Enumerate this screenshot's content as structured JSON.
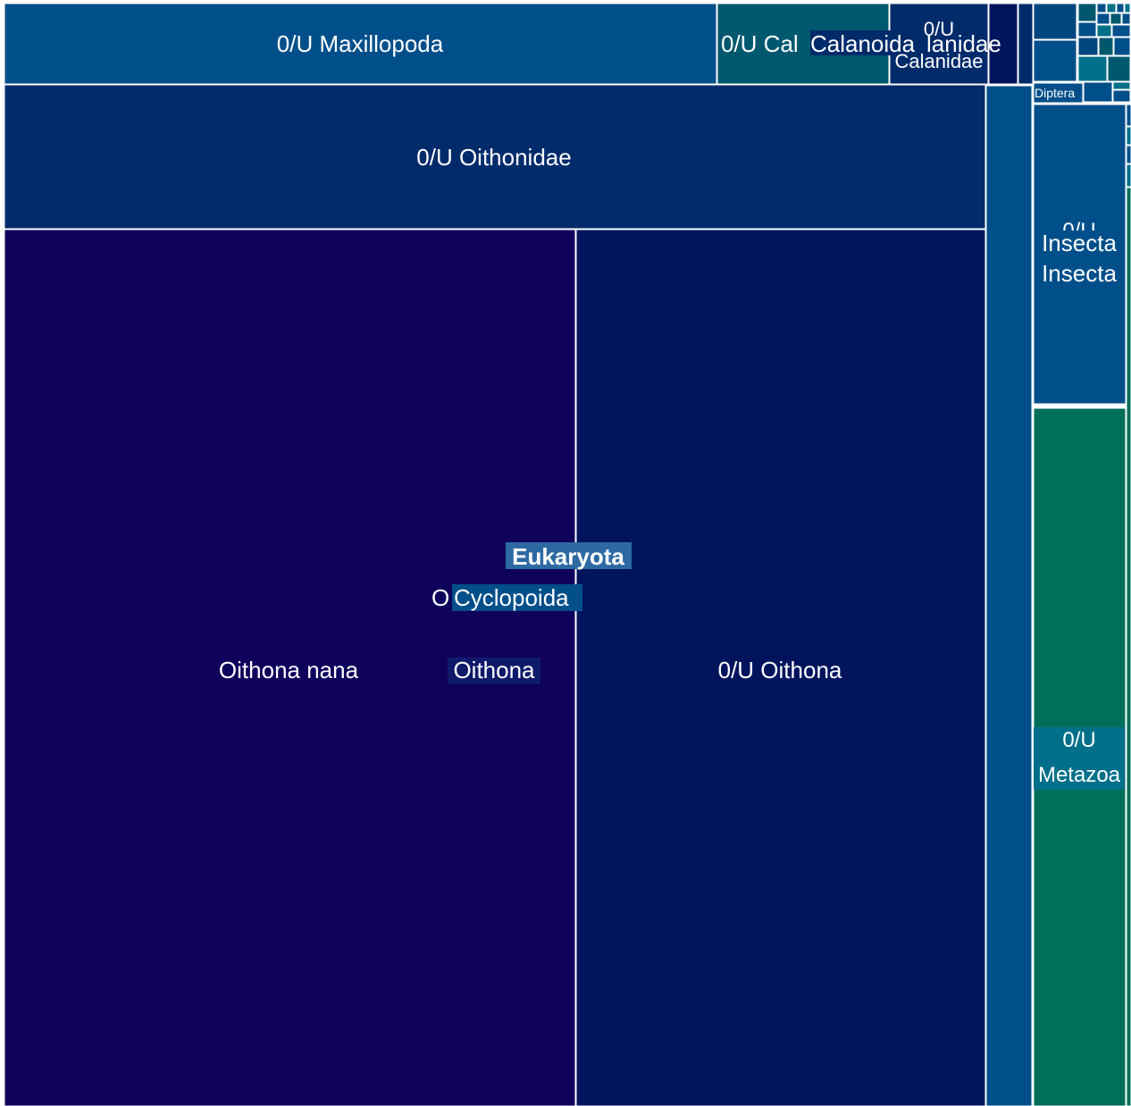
{
  "chart_data": {
    "type": "treemap",
    "title": "",
    "palette": {
      "deep_navy": "#0f005c",
      "navy": "#00145e",
      "blue_navy": "#002b6b",
      "blue": "#004f8a",
      "mid_blue": "#00477f",
      "teal_blue": "#00586f",
      "teal": "#00708a",
      "green": "#006f5a",
      "label_highlight": "#2d6aa3"
    },
    "nodes": [
      {
        "id": "eukaryota",
        "name": "Eukaryota",
        "parent": "",
        "value": 1000,
        "color": "#002b6b"
      },
      {
        "id": "metazoa",
        "name": "Metazoa",
        "parent": "eukaryota",
        "value": 1000,
        "color": "#002b6b"
      },
      {
        "id": "cyclopoida",
        "name": "Cyclopoida",
        "parent": "metazoa",
        "value": 710,
        "color": "#00145e"
      },
      {
        "id": "oithona",
        "name": "Oithona",
        "parent": "cyclopoida",
        "value": 620,
        "color": "#00145e"
      },
      {
        "id": "oithona-nana",
        "name": "Oithona nana",
        "parent": "oithona",
        "value": 360,
        "color": "#0f005c"
      },
      {
        "id": "ou-oithona",
        "name": "0/U Oithona",
        "parent": "oithona",
        "value": 260,
        "color": "#00145e"
      },
      {
        "id": "ou-oithonidae",
        "name": "0/U Oithonidae",
        "parent": "cyclopoida",
        "value": 90,
        "color": "#002b6b"
      },
      {
        "id": "ou-maxillopoda",
        "name": "0/U Maxillopoda",
        "parent": "metazoa",
        "value": 60,
        "color": "#004f8a"
      },
      {
        "id": "calanoida",
        "name": "Calanoida",
        "parent": "metazoa",
        "value": 30,
        "color": "#00586f"
      },
      {
        "id": "ou-calanoida",
        "name": "0/U Calanoida",
        "parent": "calanoida",
        "value": 14,
        "color": "#00586f"
      },
      {
        "id": "calanidae",
        "name": "Calanidae",
        "parent": "calanoida",
        "value": 10,
        "color": "#002b6b"
      },
      {
        "id": "ou-calanidae",
        "name": "0/U Calanidae",
        "parent": "calanidae",
        "value": 8,
        "color": "#002b6b"
      },
      {
        "id": "insecta",
        "name": "Insecta",
        "parent": "metazoa",
        "value": 40,
        "color": "#004f8a"
      },
      {
        "id": "ou-insecta",
        "name": "0/U Insecta",
        "parent": "insecta",
        "value": 30,
        "color": "#004f8a"
      },
      {
        "id": "diptera",
        "name": "Diptera",
        "parent": "insecta",
        "value": 4,
        "color": "#004f8a"
      },
      {
        "id": "ou-metazoa",
        "name": "0/U Metazoa",
        "parent": "metazoa",
        "value": 60,
        "color": "#006f5a"
      }
    ],
    "labels": {
      "eukaryota": "Eukaryota",
      "cyclopoida": "Cyclopoida",
      "cyclopoida_prefix": "O",
      "oithona": "Oithona",
      "oithona_nana": "Oithona nana",
      "ou_oithona": "0/U Oithona",
      "ou_oithonidae": "0/U Oithonidae",
      "ou_maxillopoda": "0/U Maxillopoda",
      "ou_calanoida_partial": "0/U Cal",
      "calanoida_overlay": "Calanoida",
      "calanidae_tail": "lanidae",
      "ou_calanidae_top": "0/U",
      "ou_calanidae_bottom": "Calanidae",
      "ou_insecta_top": "0/U",
      "insecta": "Insecta",
      "ou_insecta_bottom": "Insecta",
      "diptera": "Diptera",
      "ou_metazoa_top": "0/U",
      "ou_metazoa_bottom": "Metazoa"
    }
  }
}
